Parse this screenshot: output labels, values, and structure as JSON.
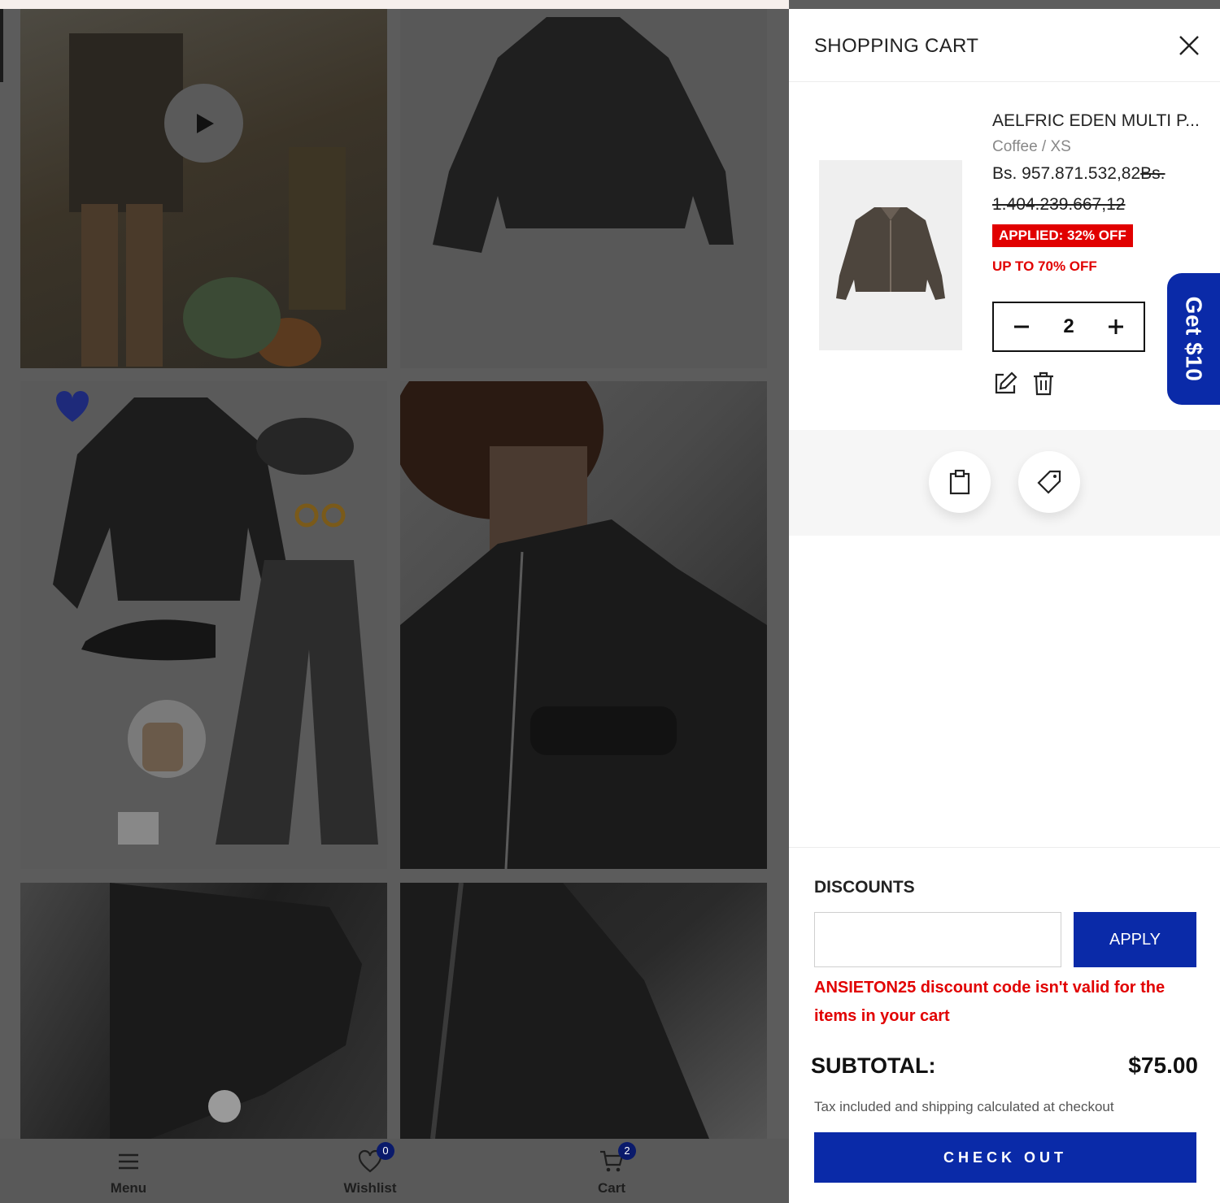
{
  "cart": {
    "title": "SHOPPING CART",
    "item": {
      "name": "AELFRIC EDEN MULTI P...",
      "variant": "Coffee / XS",
      "price": "Bs. 957.871.532,82",
      "was_part1": "Bs.",
      "was_part2": "1.404.239.667,12",
      "applied": "APPLIED: 32% OFF",
      "promo": "UP TO 70% OFF",
      "quantity": "2"
    },
    "discounts": {
      "title": "DISCOUNTS",
      "input_value": "",
      "apply": "APPLY",
      "error": "ANSIETON25 discount code isn't valid for the items in your cart"
    },
    "subtotal_label": "SUBTOTAL:",
    "subtotal_value": "$75.00",
    "tax_note": "Tax included and shipping calculated at checkout",
    "checkout": "CHECK OUT"
  },
  "side_tab": "Get $10",
  "bottom_nav": {
    "menu": "Menu",
    "wishlist": "Wishlist",
    "wishlist_count": "0",
    "cart": "Cart",
    "cart_count": "2"
  },
  "colors": {
    "primary": "#0a2aa8",
    "sale": "#e10000",
    "badge": "#0a1a6b"
  }
}
